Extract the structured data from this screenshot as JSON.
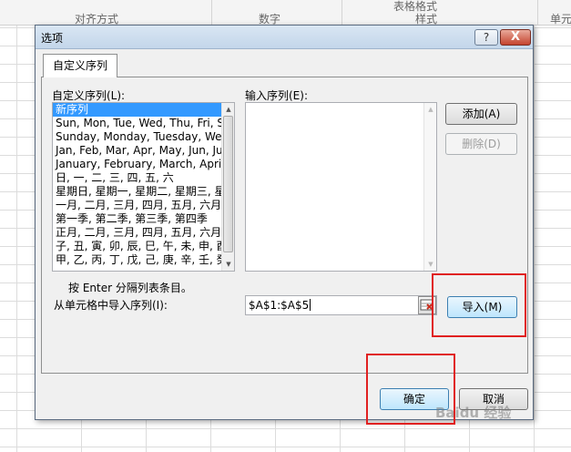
{
  "background": {
    "header_labels": [
      "对齐方式",
      "数字",
      "表格格式",
      "样式",
      "单元"
    ]
  },
  "dialog": {
    "title": "选项",
    "help_label": "?",
    "close_label": "X",
    "tab_label": "自定义序列",
    "custom_lists_label": "自定义序列(L):",
    "custom_lists": [
      "新序列",
      "Sun, Mon, Tue, Wed, Thu, Fri, S",
      "Sunday, Monday, Tuesday, Wed",
      "Jan, Feb, Mar, Apr, May, Jun, Ju",
      "January, February, March, April,",
      "日, 一, 二, 三, 四, 五, 六",
      "星期日, 星期一, 星期二, 星期三, 星",
      "一月, 二月, 三月, 四月, 五月, 六月,",
      "第一季, 第二季, 第三季, 第四季",
      "正月, 二月, 三月, 四月, 五月, 六月,",
      "子, 丑, 寅, 卯, 辰, 巳, 午, 未, 申, 酉",
      "甲, 乙, 丙, 丁, 戊, 己, 庚, 辛, 壬, 癸"
    ],
    "entries_label": "输入序列(E):",
    "add_label": "添加(A)",
    "delete_label": "删除(D)",
    "hint": "按 Enter 分隔列表条目。",
    "import_from_label": "从单元格中导入序列(I):",
    "import_range_value": "$A$1:$A$5",
    "import_label": "导入(M)",
    "ok_label": "确定",
    "cancel_label": "取消"
  },
  "watermark": "Baidu 经验",
  "colors": {
    "selection": "#3399ff",
    "highlight_box": "#e02020"
  }
}
